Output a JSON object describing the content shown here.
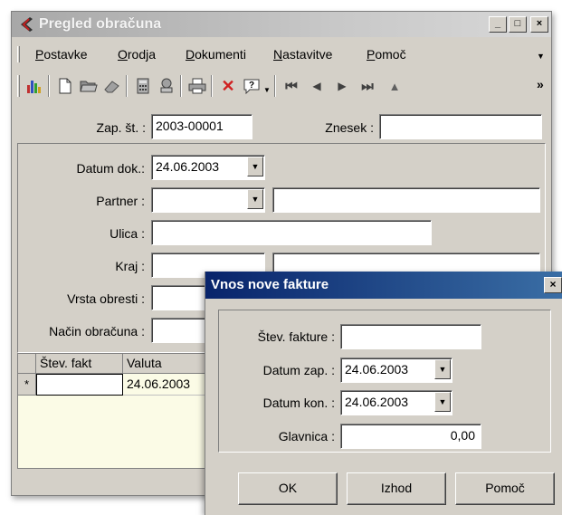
{
  "window": {
    "title": "Pregled obračuna",
    "controls": {
      "minimize": "_",
      "maximize": "□",
      "close": "×"
    }
  },
  "menu": [
    {
      "label": "Postavke",
      "mnemonic": "P",
      "rest": "ostavke"
    },
    {
      "label": "Orodja",
      "mnemonic": "O",
      "rest": "rodja"
    },
    {
      "label": "Dokumenti",
      "mnemonic": "D",
      "rest": "okumenti"
    },
    {
      "label": "Nastavitve",
      "mnemonic": "N",
      "rest": "astavitve"
    },
    {
      "label": "Pomoč",
      "mnemonic": "P",
      "rest": "omoč"
    }
  ],
  "toolbar": {
    "icons": [
      "chart-icon",
      "new-document-icon",
      "open-folder-icon",
      "eraser-icon",
      "calculator-icon",
      "tree-icon",
      "print-icon",
      "delete-icon",
      "help-icon",
      "first-record-icon",
      "previous-record-icon",
      "next-record-icon",
      "last-record-icon",
      "up-icon"
    ],
    "overflow": "»"
  },
  "header": {
    "zap_st_label": "Zap. št. :",
    "zap_st_value": "2003-00001",
    "znesek_label": "Znesek :",
    "znesek_value": ""
  },
  "form": {
    "datum_dok_label": "Datum dok.:",
    "datum_dok_value": "24.06.2003",
    "partner_label": "Partner :",
    "partner_value": "",
    "partner_name_value": "",
    "ulica_label": "Ulica :",
    "ulica_value": "",
    "kraj_label": "Kraj :",
    "kraj_value": "",
    "vrsta_obresti_label": "Vrsta obresti :",
    "vrsta_obresti_value": "",
    "nacin_obracuna_label": "Način obračuna :",
    "nacin_obracuna_value": ""
  },
  "grid": {
    "columns": [
      "Štev. fakt",
      "Valuta"
    ],
    "rows": [
      {
        "marker": "*",
        "stev_fakt": "",
        "valuta": "24.06.2003"
      }
    ]
  },
  "dialog": {
    "title": "Vnos nove fakture",
    "close": "×",
    "stev_fakture_label": "Štev. fakture :",
    "stev_fakture_value": "",
    "datum_zap_label": "Datum zap. :",
    "datum_zap_value": "24.06.2003",
    "datum_kon_label": "Datum kon. :",
    "datum_kon_value": "24.06.2003",
    "glavnica_label": "Glavnica :",
    "glavnica_value": "0,00",
    "buttons": {
      "ok": "OK",
      "izhod": "Izhod",
      "pomoc": "Pomoč"
    }
  },
  "colors": {
    "window_face": "#d4d0c8",
    "active_title_start": "#08246b",
    "active_title_end": "#3a6ea5",
    "inactive_title": "#a8a8a8",
    "grid_background": "#fbfbe6"
  }
}
